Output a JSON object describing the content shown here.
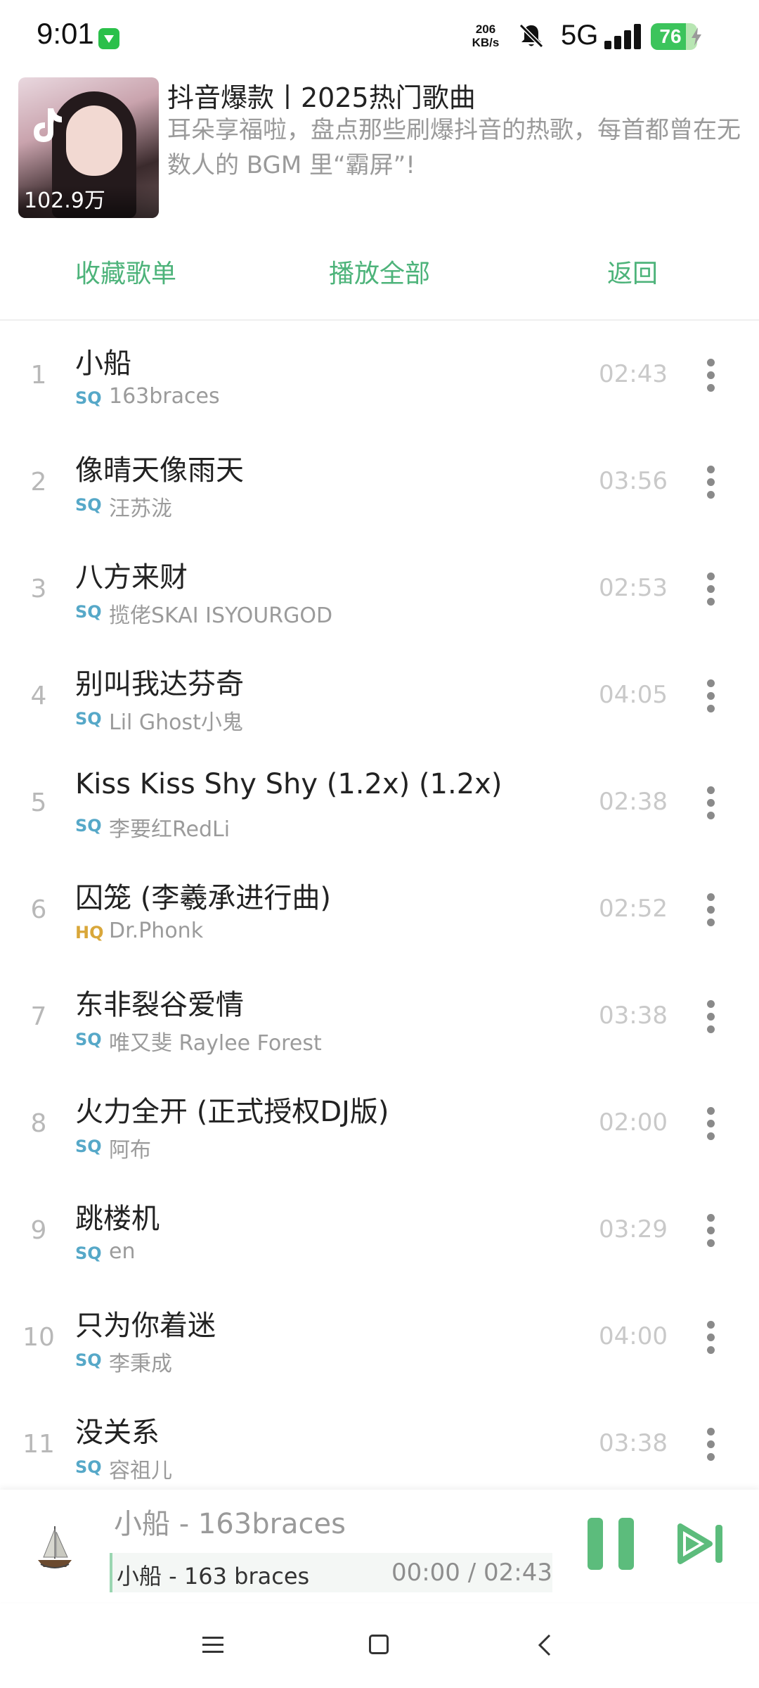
{
  "status": {
    "time": "9:01",
    "net_speed_top": "206",
    "net_speed_bottom": "KB/s",
    "network": "5G",
    "battery": "76",
    "battery_level": 0.76,
    "icons": [
      "app-badge-icon",
      "mute-bell-icon",
      "signal-icon",
      "charging-bolt-icon"
    ]
  },
  "playlist": {
    "title": "抖音爆款丨2025热门歌曲",
    "description": "耳朵享福啦，盘点那些刷爆抖音的热歌，每首都曾在无数人的 BGM 里“霸屏”!",
    "play_count": "102.9万"
  },
  "actions": {
    "collect": "收藏歌单",
    "play_all": "播放全部",
    "back": "返回"
  },
  "songs": [
    {
      "num": "1",
      "title": "小船",
      "quality": "SQ",
      "artist": "163braces",
      "duration": "02:43"
    },
    {
      "num": "2",
      "title": "像晴天像雨天",
      "quality": "SQ",
      "artist": "汪苏泷",
      "duration": "03:56"
    },
    {
      "num": "3",
      "title": "八方来财",
      "quality": "SQ",
      "artist": "揽佬SKAI ISYOURGOD",
      "duration": "02:53"
    },
    {
      "num": "4",
      "title": "别叫我达芬奇",
      "quality": "SQ",
      "artist": "Lil Ghost小鬼",
      "duration": "04:05"
    },
    {
      "num": "5",
      "title": "Kiss Kiss Shy Shy (1.2x) (1.2x)",
      "quality": "SQ",
      "artist": "李要红RedLi",
      "duration": "02:38"
    },
    {
      "num": "6",
      "title": "囚笼 (李羲承进行曲)",
      "quality": "HQ",
      "artist": "Dr.Phonk",
      "duration": "02:52"
    },
    {
      "num": "7",
      "title": "东非裂谷爱情",
      "quality": "SQ",
      "artist": "唯又斐 Raylee Forest",
      "duration": "03:38"
    },
    {
      "num": "8",
      "title": "火力全开 (正式授权DJ版)",
      "quality": "SQ",
      "artist": "阿布",
      "duration": "02:00"
    },
    {
      "num": "9",
      "title": "跳楼机",
      "quality": "SQ",
      "artist": "en",
      "duration": "03:29"
    },
    {
      "num": "10",
      "title": "只为你着迷",
      "quality": "SQ",
      "artist": "李秉成",
      "duration": "04:00"
    },
    {
      "num": "11",
      "title": "没关系",
      "quality": "SQ",
      "artist": "容祖儿",
      "duration": "03:38"
    }
  ],
  "player": {
    "track": "小船 - 163braces",
    "lyric": "小船 - 163 braces",
    "time": "00:00 / 02:43",
    "progress": 0
  },
  "colors": {
    "accent": "#4db37a",
    "sq": "#56a8c8",
    "hq": "#d9a73a"
  }
}
